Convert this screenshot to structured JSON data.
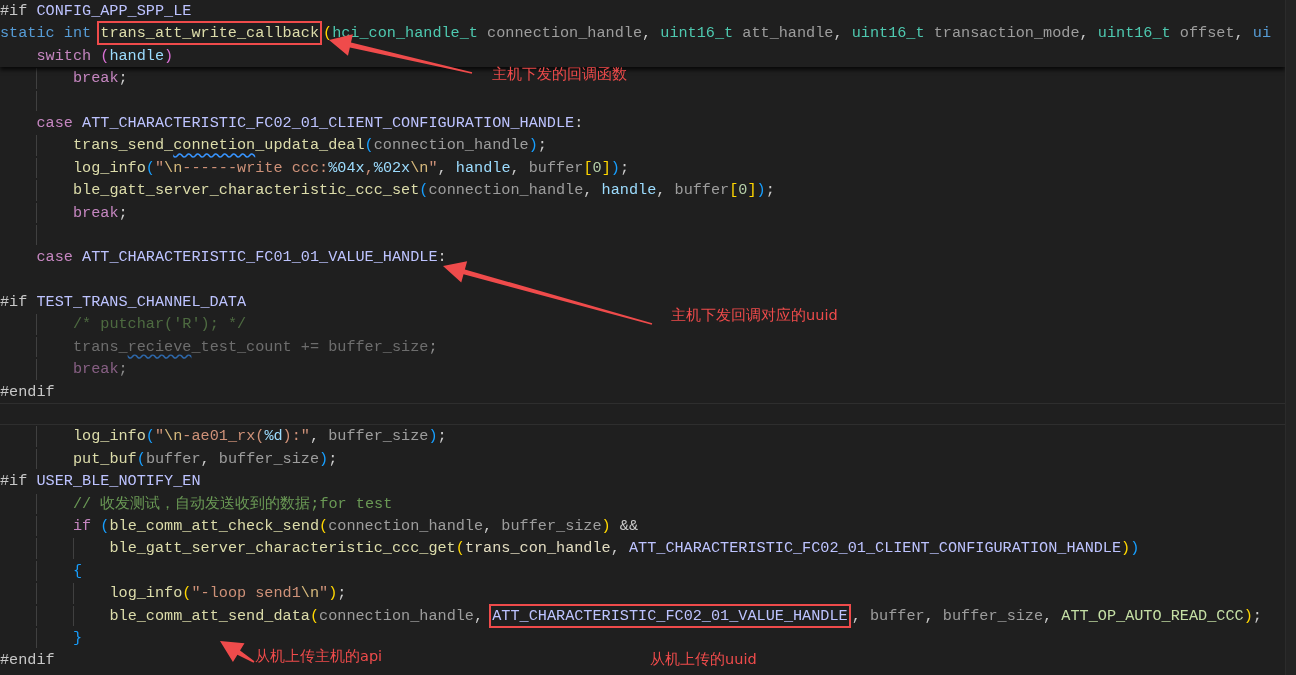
{
  "editor": {
    "sticky_lines": [
      {
        "kind": "code",
        "tokens": [
          {
            "text": "#if",
            "kind": "preproc"
          },
          {
            "text": " CONFIG_APP_SPP_LE",
            "kind": "macro"
          }
        ]
      },
      {
        "kind": "code",
        "tokens": [
          {
            "text": "static",
            "kind": "keyword"
          },
          {
            "text": " int ",
            "kind": "keyword"
          },
          {
            "text": "trans_att_write_callback",
            "kind": "function",
            "boxed": true
          },
          {
            "text": "(",
            "kind": "bracket1"
          },
          {
            "text": "hci_con_handle_t",
            "kind": "type"
          },
          {
            "text": " connection_handle",
            "kind": "param"
          },
          {
            "text": ", ",
            "kind": "punct"
          },
          {
            "text": "uint16_t",
            "kind": "type"
          },
          {
            "text": " att_handle",
            "kind": "param"
          },
          {
            "text": ", ",
            "kind": "punct"
          },
          {
            "text": "uint16_t",
            "kind": "type"
          },
          {
            "text": " transaction_mode",
            "kind": "param"
          },
          {
            "text": ", ",
            "kind": "punct"
          },
          {
            "text": "uint16_t",
            "kind": "type"
          },
          {
            "text": " offset",
            "kind": "param"
          },
          {
            "text": ", ",
            "kind": "punct"
          },
          {
            "text": "ui",
            "kind": "keyword"
          }
        ],
        "children": [
          {
            "kind": "code",
            "tokens": [
              {
                "text": "switch",
                "kind": "control"
              },
              {
                "text": " (",
                "kind": "bracket2"
              },
              {
                "text": "handle",
                "kind": "variable"
              },
              {
                "text": ")",
                "kind": "bracket2"
              }
            ]
          }
        ]
      }
    ],
    "lines": [
      {
        "kind": "group",
        "children": [
          {
            "kind": "group",
            "children": [
              {
                "kind": "code",
                "tokens": [
                  {
                    "text": "break",
                    "kind": "control"
                  },
                  {
                    "text": ";",
                    "kind": "punct"
                  }
                ]
              },
              {
                "kind": "blank"
              }
            ]
          },
          {
            "kind": "code",
            "tokens": [
              {
                "text": "case",
                "kind": "control"
              },
              {
                "text": " ATT_CHARACTERISTIC_FC02_01_CLIENT_CONFIGURATION_HANDLE",
                "kind": "macro"
              },
              {
                "text": ":",
                "kind": "punct"
              }
            ],
            "children": [
              {
                "kind": "code",
                "tokens": [
                  {
                    "text": "trans_send_",
                    "kind": "function"
                  },
                  {
                    "text": "connetion",
                    "kind": "function",
                    "misspelled": true
                  },
                  {
                    "text": "_updata_deal",
                    "kind": "function"
                  },
                  {
                    "text": "(",
                    "kind": "bracket3"
                  },
                  {
                    "text": "connection_handle",
                    "kind": "param"
                  },
                  {
                    "text": ")",
                    "kind": "bracket3"
                  },
                  {
                    "text": ";",
                    "kind": "punct"
                  }
                ]
              },
              {
                "kind": "code",
                "tokens": [
                  {
                    "text": "log_info",
                    "kind": "function"
                  },
                  {
                    "text": "(",
                    "kind": "bracket3"
                  },
                  {
                    "text": "\"",
                    "kind": "string"
                  },
                  {
                    "text": "\\n",
                    "kind": "escape"
                  },
                  {
                    "text": "------write ccc:",
                    "kind": "string"
                  },
                  {
                    "text": "%04x",
                    "kind": "format"
                  },
                  {
                    "text": ",",
                    "kind": "string"
                  },
                  {
                    "text": "%02x",
                    "kind": "format"
                  },
                  {
                    "text": "\\n",
                    "kind": "escape"
                  },
                  {
                    "text": "\"",
                    "kind": "string"
                  },
                  {
                    "text": ", ",
                    "kind": "punct"
                  },
                  {
                    "text": "handle",
                    "kind": "variable"
                  },
                  {
                    "text": ", ",
                    "kind": "punct"
                  },
                  {
                    "text": "buffer",
                    "kind": "param"
                  },
                  {
                    "text": "[",
                    "kind": "bracket1"
                  },
                  {
                    "text": "0",
                    "kind": "number"
                  },
                  {
                    "text": "]",
                    "kind": "bracket1"
                  },
                  {
                    "text": ")",
                    "kind": "bracket3"
                  },
                  {
                    "text": ";",
                    "kind": "punct"
                  }
                ]
              },
              {
                "kind": "code",
                "tokens": [
                  {
                    "text": "ble_gatt_server_characteristic_ccc_set",
                    "kind": "function"
                  },
                  {
                    "text": "(",
                    "kind": "bracket3"
                  },
                  {
                    "text": "connection_handle",
                    "kind": "param"
                  },
                  {
                    "text": ", ",
                    "kind": "punct"
                  },
                  {
                    "text": "handle",
                    "kind": "variable"
                  },
                  {
                    "text": ", ",
                    "kind": "punct"
                  },
                  {
                    "text": "buffer",
                    "kind": "param"
                  },
                  {
                    "text": "[",
                    "kind": "bracket1"
                  },
                  {
                    "text": "0",
                    "kind": "number"
                  },
                  {
                    "text": "]",
                    "kind": "bracket1"
                  },
                  {
                    "text": ")",
                    "kind": "bracket3"
                  },
                  {
                    "text": ";",
                    "kind": "punct"
                  }
                ]
              },
              {
                "kind": "code",
                "tokens": [
                  {
                    "text": "break",
                    "kind": "control"
                  },
                  {
                    "text": ";",
                    "kind": "punct"
                  }
                ]
              },
              {
                "kind": "blank"
              }
            ]
          },
          {
            "kind": "code",
            "tokens": [
              {
                "text": "case",
                "kind": "control"
              },
              {
                "text": " ATT_CHARACTERISTIC_FC01_01_VALUE_HANDLE",
                "kind": "macro"
              },
              {
                "text": ":",
                "kind": "punct"
              }
            ]
          }
        ]
      },
      {
        "kind": "blank"
      },
      {
        "kind": "code",
        "tokens": [
          {
            "text": "#if",
            "kind": "preproc"
          },
          {
            "text": " TEST_TRANS_CHANNEL_DATA",
            "kind": "macro"
          }
        ],
        "children": [
          {
            "kind": "group",
            "children": [
              {
                "kind": "code",
                "inactive": true,
                "tokens": [
                  {
                    "text": "/* putchar('R'); */",
                    "kind": "comment"
                  }
                ]
              },
              {
                "kind": "code",
                "inactive": true,
                "tokens": [
                  {
                    "text": "trans_",
                    "kind": "param"
                  },
                  {
                    "text": "recieve",
                    "kind": "param",
                    "misspelled": true
                  },
                  {
                    "text": "_test_count += buffer_size",
                    "kind": "param"
                  },
                  {
                    "text": ";",
                    "kind": "punct"
                  }
                ]
              },
              {
                "kind": "code",
                "inactive": true,
                "tokens": [
                  {
                    "text": "break",
                    "kind": "control"
                  },
                  {
                    "text": ";",
                    "kind": "punct"
                  }
                ]
              }
            ]
          }
        ]
      },
      {
        "kind": "code",
        "tokens": [
          {
            "text": "#endif",
            "kind": "preproc"
          }
        ]
      },
      {
        "kind": "blank",
        "current": true
      },
      {
        "kind": "group",
        "children": [
          {
            "kind": "group",
            "children": [
              {
                "kind": "code",
                "tokens": [
                  {
                    "text": "log_info",
                    "kind": "function"
                  },
                  {
                    "text": "(",
                    "kind": "bracket3"
                  },
                  {
                    "text": "\"",
                    "kind": "string"
                  },
                  {
                    "text": "\\n",
                    "kind": "escape"
                  },
                  {
                    "text": "-ae01_rx(",
                    "kind": "string"
                  },
                  {
                    "text": "%d",
                    "kind": "format"
                  },
                  {
                    "text": "):\"",
                    "kind": "string"
                  },
                  {
                    "text": ", ",
                    "kind": "punct"
                  },
                  {
                    "text": "buffer_size",
                    "kind": "param"
                  },
                  {
                    "text": ")",
                    "kind": "bracket3"
                  },
                  {
                    "text": ";",
                    "kind": "punct"
                  }
                ]
              },
              {
                "kind": "code",
                "tokens": [
                  {
                    "text": "put_buf",
                    "kind": "function"
                  },
                  {
                    "text": "(",
                    "kind": "bracket3"
                  },
                  {
                    "text": "buffer",
                    "kind": "param"
                  },
                  {
                    "text": ", ",
                    "kind": "punct"
                  },
                  {
                    "text": "buffer_size",
                    "kind": "param"
                  },
                  {
                    "text": ")",
                    "kind": "bracket3"
                  },
                  {
                    "text": ";",
                    "kind": "punct"
                  }
                ]
              }
            ]
          }
        ]
      },
      {
        "kind": "code",
        "tokens": [
          {
            "text": "#if",
            "kind": "preproc"
          },
          {
            "text": " USER_BLE_NOTIFY_EN",
            "kind": "macro"
          }
        ],
        "children": [
          {
            "kind": "group",
            "children": [
              {
                "kind": "code",
                "tokens": [
                  {
                    "text": "// 收发测试，自动发送收到的数据;for test",
                    "kind": "comment"
                  }
                ]
              },
              {
                "kind": "code",
                "tokens": [
                  {
                    "text": "if",
                    "kind": "control"
                  },
                  {
                    "text": " (",
                    "kind": "bracket3"
                  },
                  {
                    "text": "ble_comm_att_check_send",
                    "kind": "function"
                  },
                  {
                    "text": "(",
                    "kind": "bracket1"
                  },
                  {
                    "text": "connection_handle",
                    "kind": "param"
                  },
                  {
                    "text": ", ",
                    "kind": "punct"
                  },
                  {
                    "text": "buffer_size",
                    "kind": "param"
                  },
                  {
                    "text": ")",
                    "kind": "bracket1"
                  },
                  {
                    "text": " &&",
                    "kind": "punct"
                  }
                ],
                "children": [
                  {
                    "kind": "code",
                    "tokens": [
                      {
                        "text": "ble_gatt_server_characteristic_ccc_get",
                        "kind": "function"
                      },
                      {
                        "text": "(",
                        "kind": "bracket1"
                      },
                      {
                        "text": "trans_con_handle",
                        "kind": "plain"
                      },
                      {
                        "text": ", ",
                        "kind": "punct"
                      },
                      {
                        "text": "ATT_CHARACTERISTIC_FC02_01_CLIENT_CONFIGURATION_HANDLE",
                        "kind": "macro"
                      },
                      {
                        "text": ")",
                        "kind": "bracket1"
                      },
                      {
                        "text": ")",
                        "kind": "bracket3"
                      }
                    ]
                  }
                ]
              },
              {
                "kind": "code",
                "tokens": [
                  {
                    "text": "{",
                    "kind": "bracket3"
                  }
                ],
                "children": [
                  {
                    "kind": "code",
                    "tokens": [
                      {
                        "text": "log_info",
                        "kind": "function"
                      },
                      {
                        "text": "(",
                        "kind": "bracket1"
                      },
                      {
                        "text": "\"-loop send1",
                        "kind": "string"
                      },
                      {
                        "text": "\\n",
                        "kind": "escape"
                      },
                      {
                        "text": "\"",
                        "kind": "string"
                      },
                      {
                        "text": ")",
                        "kind": "bracket1"
                      },
                      {
                        "text": ";",
                        "kind": "punct"
                      }
                    ]
                  },
                  {
                    "kind": "code",
                    "tokens": [
                      {
                        "text": "ble_comm_att_send_data",
                        "kind": "function"
                      },
                      {
                        "text": "(",
                        "kind": "bracket1"
                      },
                      {
                        "text": "connection_handle",
                        "kind": "param"
                      },
                      {
                        "text": ", ",
                        "kind": "punct"
                      },
                      {
                        "text": "ATT_CHARACTERISTIC_FC02_01_VALUE_HANDLE",
                        "kind": "macro",
                        "boxed": true
                      },
                      {
                        "text": ", ",
                        "kind": "punct"
                      },
                      {
                        "text": "buffer",
                        "kind": "param"
                      },
                      {
                        "text": ", ",
                        "kind": "punct"
                      },
                      {
                        "text": "buffer_size",
                        "kind": "param"
                      },
                      {
                        "text": ", ",
                        "kind": "punct"
                      },
                      {
                        "text": "ATT_OP_AUTO_READ_CCC",
                        "kind": "enum"
                      },
                      {
                        "text": ")",
                        "kind": "bracket1"
                      },
                      {
                        "text": ";",
                        "kind": "punct"
                      }
                    ]
                  }
                ]
              },
              {
                "kind": "code",
                "tokens": [
                  {
                    "text": "}",
                    "kind": "bracket3"
                  }
                ]
              }
            ]
          }
        ]
      },
      {
        "kind": "code",
        "tokens": [
          {
            "text": "#endif",
            "kind": "preproc"
          }
        ]
      }
    ]
  },
  "annotations": [
    {
      "text": "主机下发的回调函数"
    },
    {
      "text": "主机下发回调对应的uuid"
    },
    {
      "text": "从机上传主机的api"
    },
    {
      "text": "从机上传的uuid"
    }
  ]
}
